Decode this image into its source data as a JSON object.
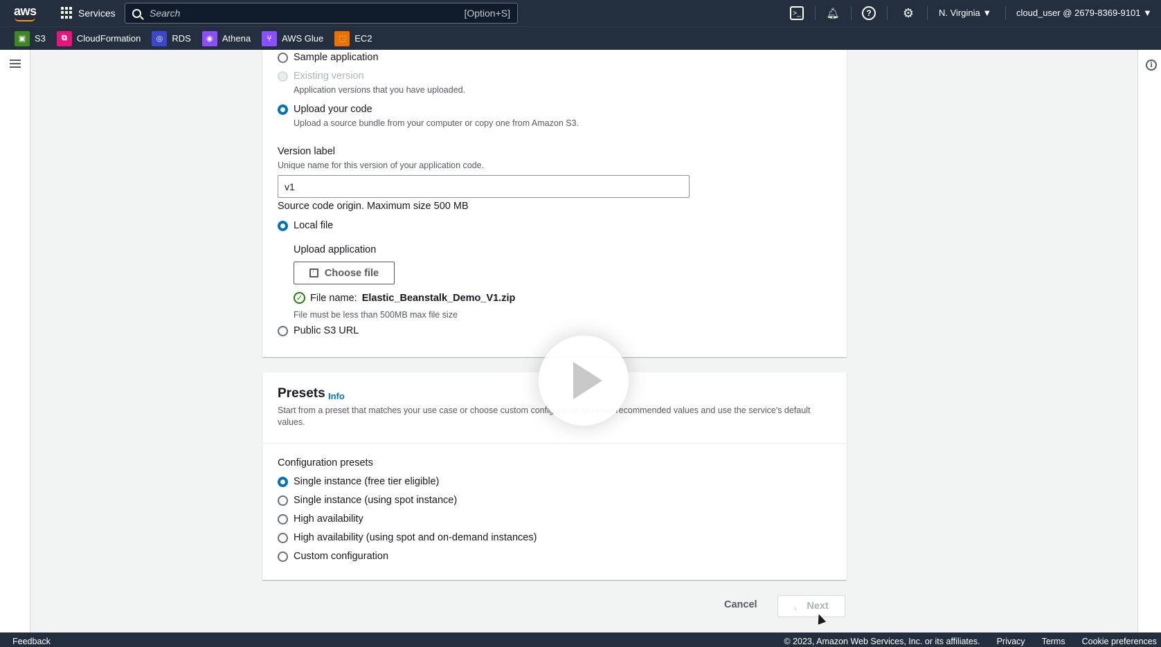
{
  "topnav": {
    "logo": "aws",
    "services_label": "Services",
    "search_placeholder": "Search",
    "search_shortcut": "[Option+S]",
    "region": "N. Virginia ▼",
    "account": "cloud_user @ 2679-8369-9101 ▼",
    "icons": [
      "cloudshell-icon",
      "bell-icon",
      "help-icon",
      "settings-icon"
    ]
  },
  "favorites": [
    {
      "label": "S3",
      "color": "#3f8624",
      "icon": "s3-icon"
    },
    {
      "label": "CloudFormation",
      "color": "#e7157b",
      "icon": "cloudformation-icon"
    },
    {
      "label": "RDS",
      "color": "#3b48cc",
      "icon": "rds-icon"
    },
    {
      "label": "Athena",
      "color": "#8c4fff",
      "icon": "athena-icon"
    },
    {
      "label": "AWS Glue",
      "color": "#8c4fff",
      "icon": "glue-icon"
    },
    {
      "label": "EC2",
      "color": "#ed7100",
      "icon": "ec2-icon"
    }
  ],
  "code": {
    "sample_application": "Sample application",
    "existing_version": "Existing version",
    "existing_version_desc": "Application versions that you have uploaded.",
    "upload_your_code": "Upload your code",
    "upload_your_code_desc": "Upload a source bundle from your computer or copy one from Amazon S3.",
    "version_label": "Version label",
    "version_label_desc": "Unique name for this version of your application code.",
    "version_value": "v1",
    "source_origin": "Source code origin. Maximum size 500 MB",
    "local_file": "Local file",
    "upload_application": "Upload application",
    "choose_file": "Choose file",
    "file_name_label": "File name:",
    "file_name_value": "Elastic_Beanstalk_Demo_V1.zip",
    "file_constraint": "File must be less than 500MB max file size",
    "public_s3_url": "Public S3 URL"
  },
  "presets": {
    "title": "Presets",
    "info": "Info",
    "desc": "Start from a preset that matches your use case or choose custom configuration to unset recommended values and use the service's default values.",
    "group_label": "Configuration presets",
    "options": [
      "Single instance (free tier eligible)",
      "Single instance (using spot instance)",
      "High availability",
      "High availability (using spot and on-demand instances)",
      "Custom configuration"
    ],
    "selected_index": 0
  },
  "actions": {
    "cancel": "Cancel",
    "next": "Next"
  },
  "footer": {
    "feedback": "Feedback",
    "copyright": "© 2023, Amazon Web Services, Inc. or its affiliates.",
    "privacy": "Privacy",
    "terms": "Terms",
    "cookies": "Cookie preferences"
  }
}
